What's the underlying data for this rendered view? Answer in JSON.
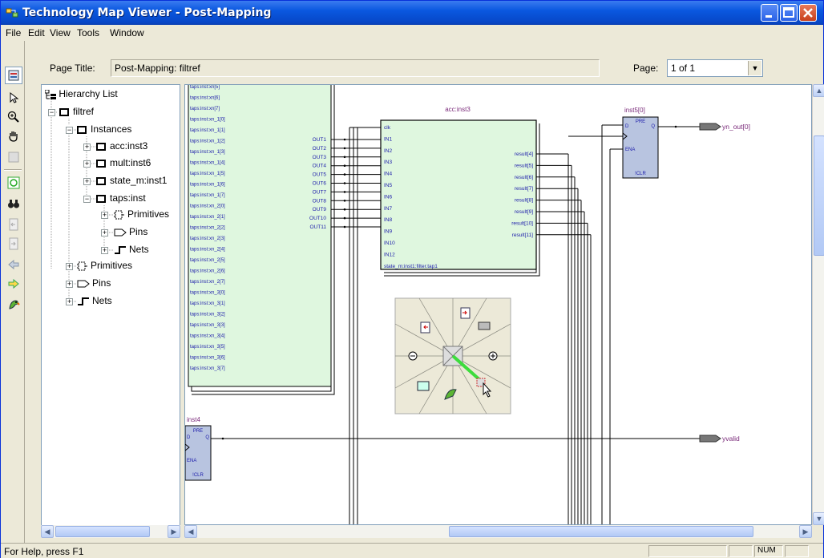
{
  "window": {
    "title": "Technology Map Viewer - Post-Mapping"
  },
  "menu": [
    "File",
    "Edit",
    "View",
    "Tools",
    "Window"
  ],
  "page_bar": {
    "page_title_label": "Page Title:",
    "page_title_value": "Post-Mapping: filtref",
    "page_label": "Page:",
    "page_value": "1 of 1"
  },
  "hierarchy": {
    "header": "Hierarchy List",
    "root": "filtref",
    "instances_label": "Instances",
    "instances": [
      "acc:inst3",
      "mult:inst6",
      "state_m:inst1",
      "taps:inst"
    ],
    "taps_children": [
      "Primitives",
      "Pins",
      "Nets"
    ],
    "root_children": [
      "Primitives",
      "Pins",
      "Nets"
    ]
  },
  "schematic": {
    "taps_pins": [
      "taps:inst:xn[5]",
      "taps:inst:xn[6]",
      "taps:inst:xn[7]",
      "taps:inst:xn_1[0]",
      "taps:inst:xn_1[1]",
      "taps:inst:xn_1[2]",
      "taps:inst:xn_1[3]",
      "taps:inst:xn_1[4]",
      "taps:inst:xn_1[5]",
      "taps:inst:xn_1[6]",
      "taps:inst:xn_1[7]",
      "taps:inst:xn_2[0]",
      "taps:inst:xn_2[1]",
      "taps:inst:xn_2[2]",
      "taps:inst:xn_2[3]",
      "taps:inst:xn_2[4]",
      "taps:inst:xn_2[5]",
      "taps:inst:xn_2[6]",
      "taps:inst:xn_2[7]",
      "taps:inst:xn_3[0]",
      "taps:inst:xn_3[1]",
      "taps:inst:xn_3[2]",
      "taps:inst:xn_3[3]",
      "taps:inst:xn_3[4]",
      "taps:inst:xn_3[5]",
      "taps:inst:xn_3[6]",
      "taps:inst:xn_3[7]"
    ],
    "taps_outputs": [
      "OUT1",
      "OUT2",
      "OUT3",
      "OUT4",
      "OUT5",
      "OUT6",
      "OUT7",
      "OUT8",
      "OUT9",
      "OUT10",
      "OUT11"
    ],
    "acc_title": "acc:inst3",
    "acc_inputs": [
      "clk",
      "IN1",
      "IN2",
      "IN3",
      "IN4",
      "IN5",
      "IN6",
      "IN7",
      "IN8",
      "IN9",
      "IN10",
      "IN12",
      "state_m:inst1:filter.tap1"
    ],
    "acc_outputs": [
      "result[4]",
      "result[5]",
      "result[6]",
      "result[7]",
      "result[8]",
      "result[9]",
      "result[10]",
      "result[11]"
    ],
    "inst5_title": "inst5[0]",
    "inst4_title": "inst4",
    "ff_pins": {
      "pre": "PRE",
      "d": "D",
      "q": "Q",
      "ena": "ENA",
      "clr": "!CLR"
    },
    "out_yn": "yn_out[0]",
    "out_yvalid": "yvalid"
  },
  "status": {
    "help": "For Help, press F1",
    "num": "NUM"
  },
  "colors": {
    "block_fill": "#dff7df",
    "ff_fill": "#b8c4e0",
    "label": "#7a2a7a",
    "pin_text": "#1a1aaa",
    "wire": "#000000"
  }
}
